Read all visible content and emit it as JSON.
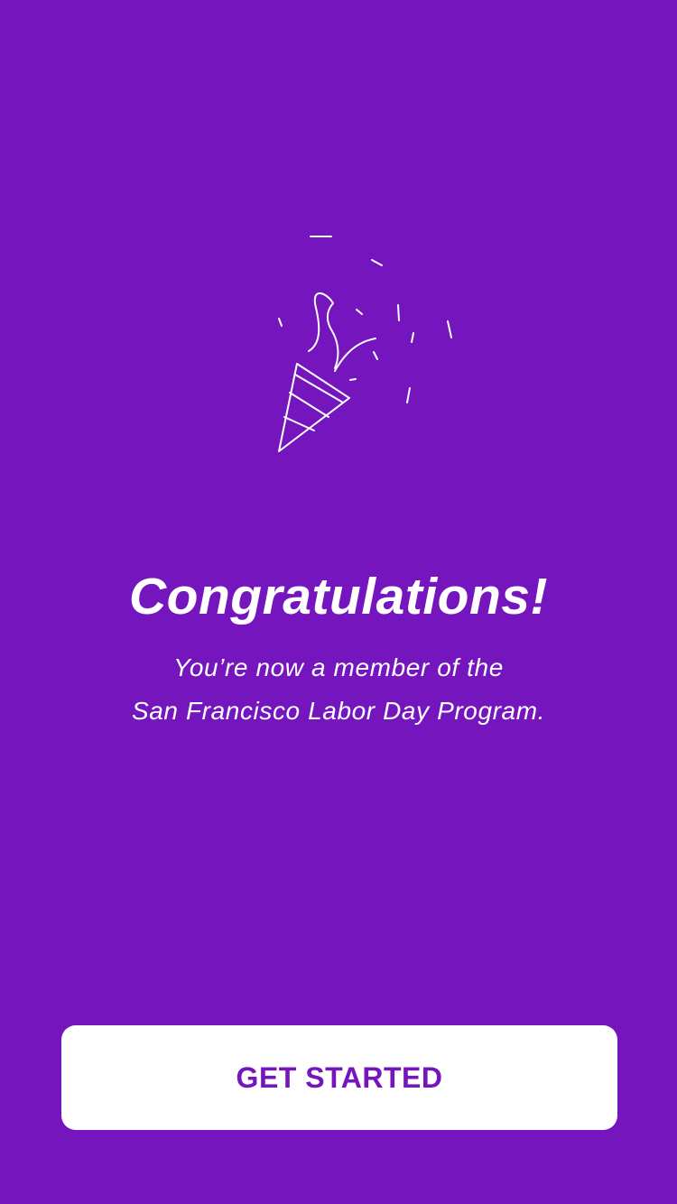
{
  "theme": {
    "background": "#7415BE",
    "text": "#FFFFFF",
    "button_background": "#FFFFFF",
    "button_text": "#7415BE"
  },
  "illustration": {
    "icon": "party-popper-icon"
  },
  "content": {
    "title": "Congratulations!",
    "subtitle_line_1": "You’re now a member of the",
    "subtitle_line_2": "San Francisco Labor Day Program."
  },
  "actions": {
    "get_started_label": "GET STARTED"
  }
}
